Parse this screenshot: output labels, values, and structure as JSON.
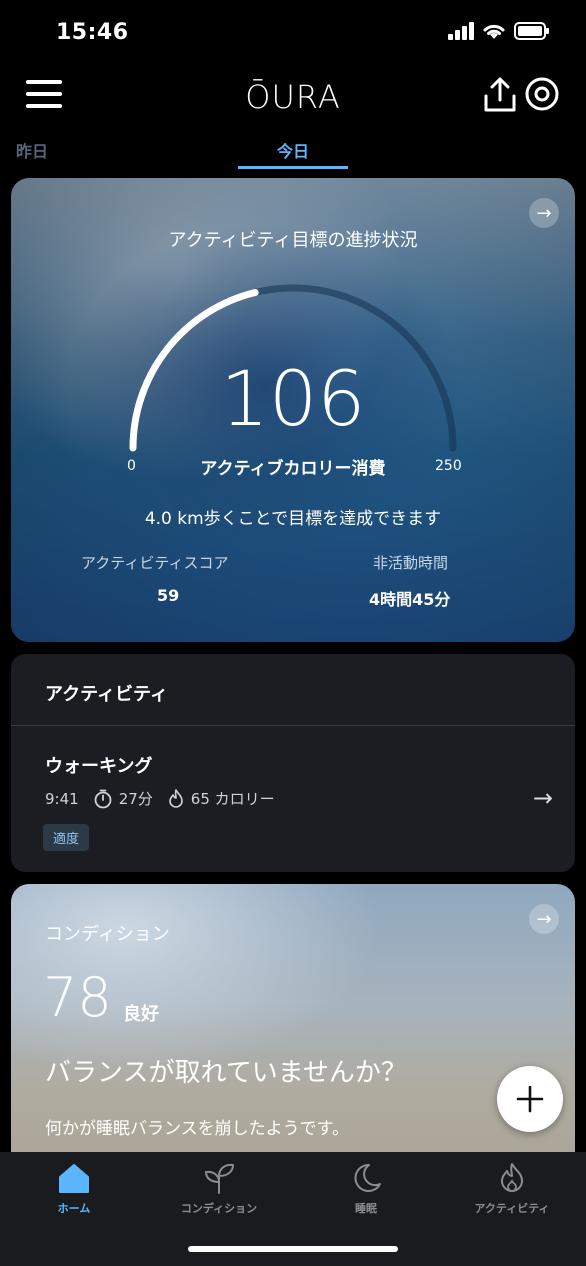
{
  "status": {
    "time": "15:46"
  },
  "header": {
    "logo": "ŌURA"
  },
  "tabs": {
    "yesterday": "昨日",
    "today": "今日"
  },
  "activity_card": {
    "title": "アクティビティ目標の進捗状況",
    "value": "106",
    "value_label": "アクティブカロリー消費",
    "gauge_min": "0",
    "gauge_max": "250",
    "hint": "4.0 km歩くことで目標を達成できます",
    "score_label": "アクティビティスコア",
    "score_value": "59",
    "inactive_label": "非活動時間",
    "inactive_value": "4時間45分"
  },
  "activity_list": {
    "title": "アクティビティ",
    "items": [
      {
        "name": "ウォーキング",
        "time": "9:41",
        "duration": "27分",
        "calories": "65 カロリー",
        "badge": "適度"
      }
    ]
  },
  "condition_card": {
    "title": "コンディション",
    "score": "78",
    "score_label": "良好",
    "heading": "バランスが取れていませんか？",
    "description": "何かが睡眠バランスを崩したようです。"
  },
  "nav": {
    "items": [
      {
        "label": "ホーム",
        "icon": "home-icon",
        "active": true
      },
      {
        "label": "コンディション",
        "icon": "sprout-icon",
        "active": false
      },
      {
        "label": "睡眠",
        "icon": "moon-icon",
        "active": false
      },
      {
        "label": "アクティビティ",
        "icon": "flame-icon",
        "active": false
      }
    ]
  },
  "colors": {
    "accent": "#5bb6ff",
    "background": "#000000",
    "card": "#1c1d22"
  }
}
